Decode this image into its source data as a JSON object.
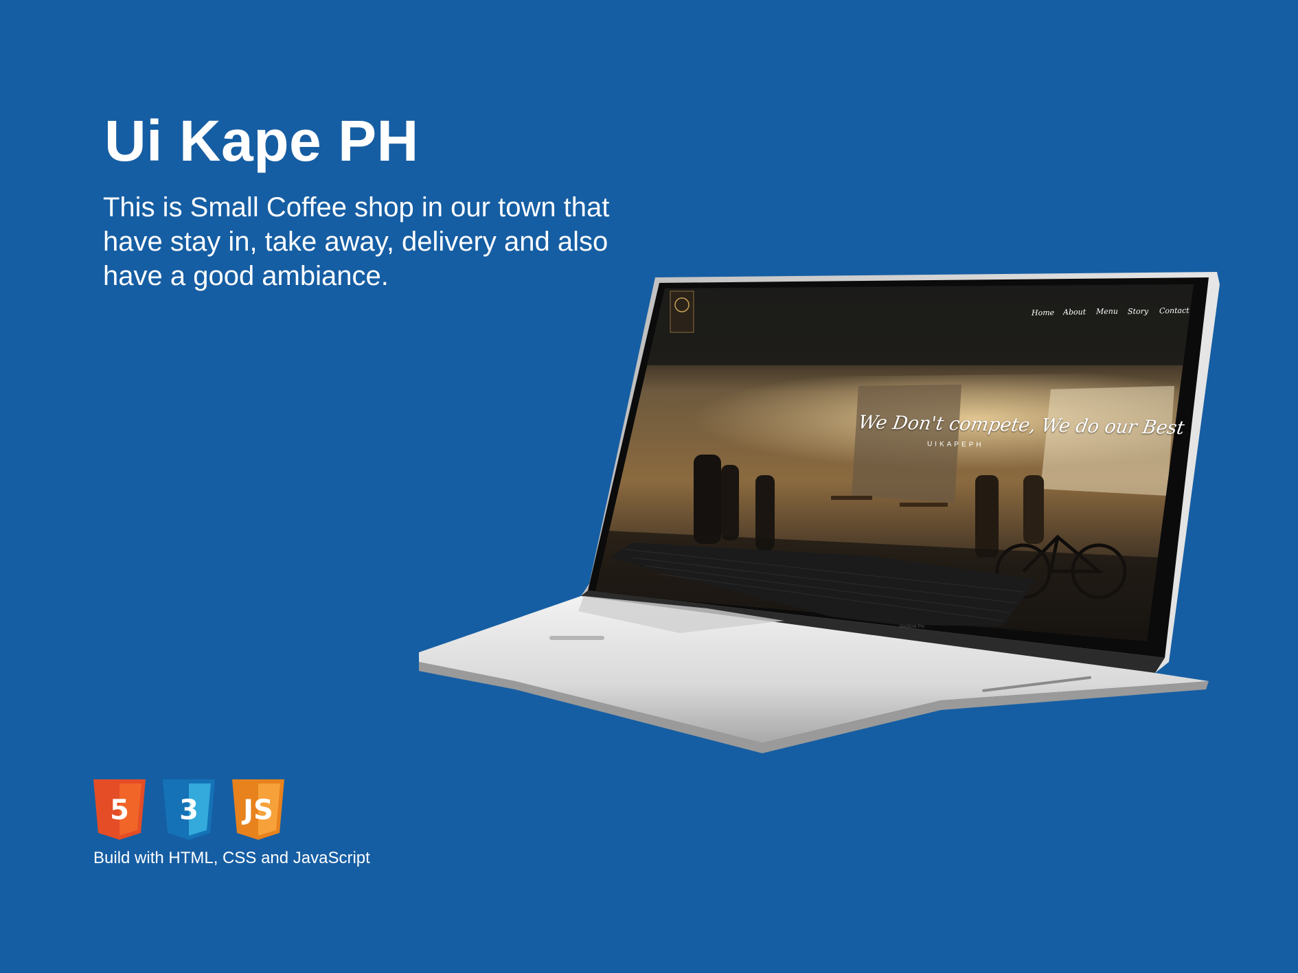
{
  "title": "Ui Kape PH",
  "description_lines": [
    "This is Small Coffee shop in our town that",
    "have stay in, take away, delivery and also",
    "have a good ambiance."
  ],
  "laptop": {
    "screen": {
      "nav": [
        "Home",
        "About",
        "Menu",
        "Story",
        "Contact"
      ],
      "hero_headline": "We Don't compete, We do our Best",
      "hero_subtitle": "UIKAPEPH"
    },
    "brand_label": "MacBook Pro"
  },
  "tech_badges": [
    {
      "icon": "html5-icon",
      "label": "5",
      "color": "#e44d26"
    },
    {
      "icon": "css3-icon",
      "label": "3",
      "color": "#1572b6"
    },
    {
      "icon": "javascript-icon",
      "label": "JS",
      "color": "#f08a24"
    }
  ],
  "footer_text": "Build with HTML, CSS and JavaScript",
  "colors": {
    "background": "#165ea3",
    "text": "#ffffff"
  }
}
